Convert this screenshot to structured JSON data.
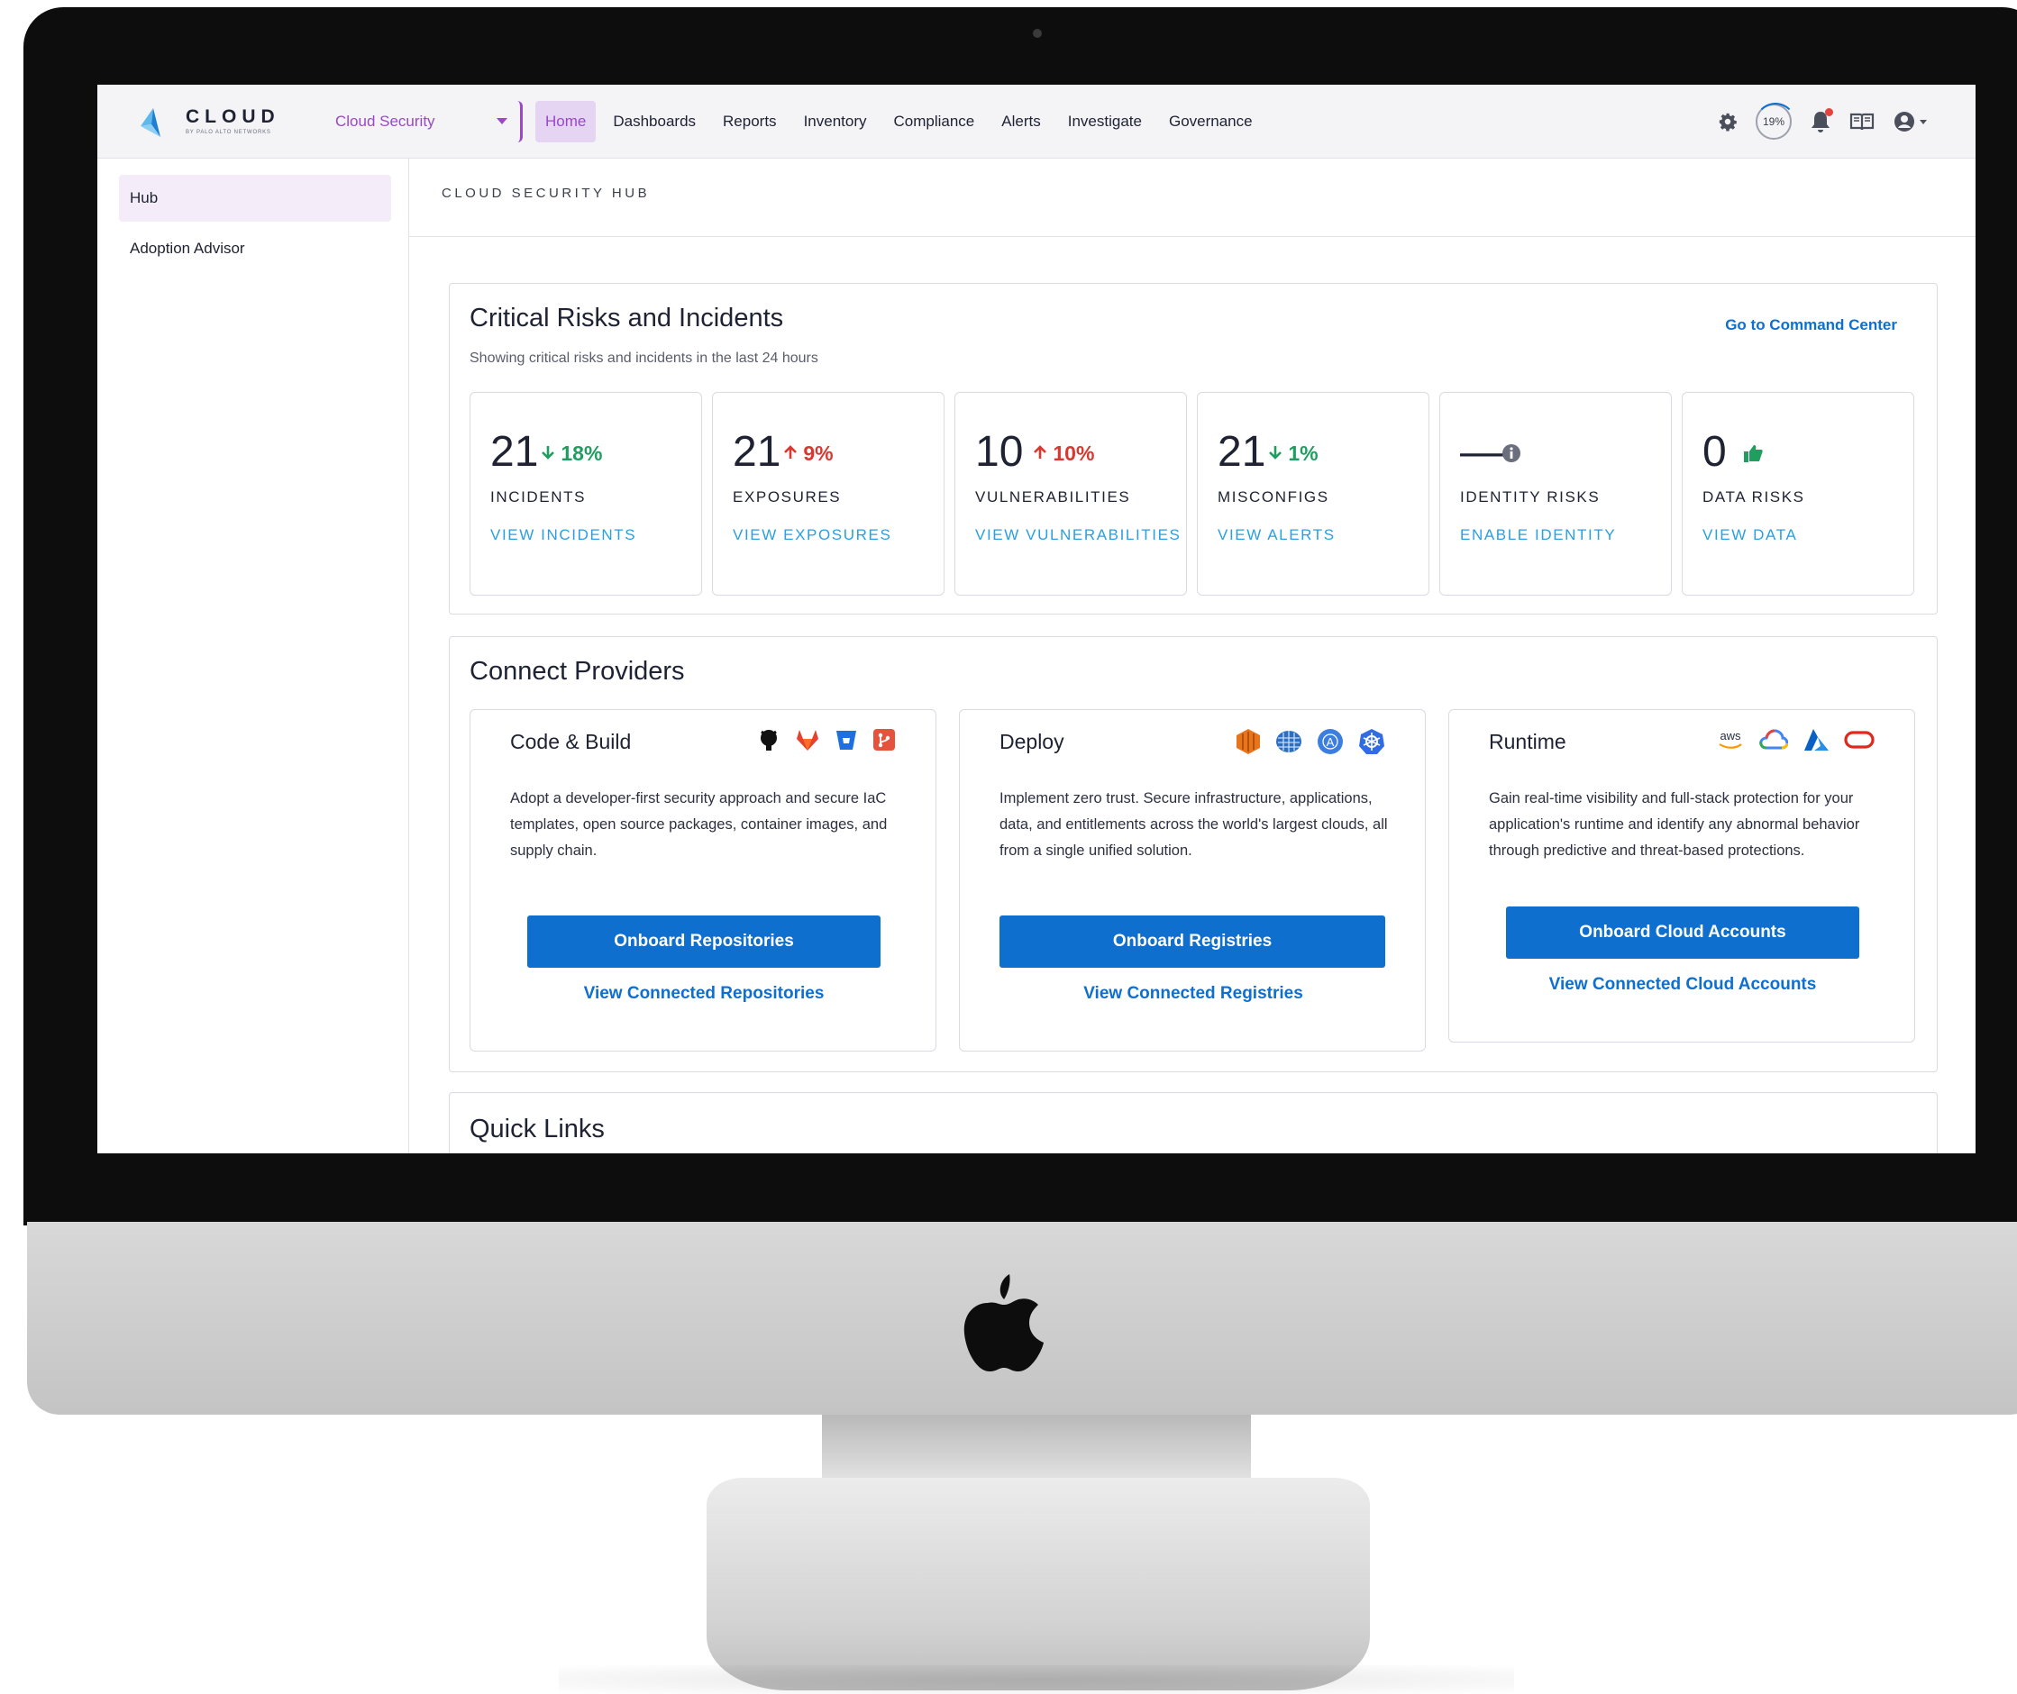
{
  "brand": {
    "name": "CLOUD",
    "subtitle": "BY PALO ALTO NETWORKS"
  },
  "product_select": {
    "value": "Cloud Security"
  },
  "nav": {
    "items": [
      {
        "label": "Home",
        "active": true
      },
      {
        "label": "Dashboards"
      },
      {
        "label": "Reports"
      },
      {
        "label": "Inventory"
      },
      {
        "label": "Compliance"
      },
      {
        "label": "Alerts"
      },
      {
        "label": "Investigate"
      },
      {
        "label": "Governance"
      }
    ]
  },
  "top_icons": {
    "settings": "gear-icon",
    "progress_label": "19%",
    "notifications": "bell-icon",
    "docs": "book-icon",
    "user": "user-icon"
  },
  "sidebar": {
    "items": [
      {
        "label": "Hub",
        "active": true
      },
      {
        "label": "Adoption Advisor"
      }
    ]
  },
  "page": {
    "title": "CLOUD SECURITY HUB"
  },
  "risks": {
    "title": "Critical Risks and Incidents",
    "subtitle": "Showing critical risks and incidents in the last 24 hours",
    "link": "Go to Command Center",
    "metrics": [
      {
        "value": "21",
        "delta": "18%",
        "direction": "down",
        "label": "INCIDENTS",
        "link": "VIEW INCIDENTS"
      },
      {
        "value": "21",
        "delta": "9%",
        "direction": "up",
        "label": "EXPOSURES",
        "link": "VIEW EXPOSURES"
      },
      {
        "value": "10",
        "delta": "10%",
        "direction": "up",
        "label": "VULNERABILITIES",
        "link": "VIEW VULNERABILITIES"
      },
      {
        "value": "21",
        "delta": "1%",
        "direction": "down",
        "label": "MISCONFIGS",
        "link": "VIEW ALERTS"
      },
      {
        "value": "—",
        "delta": "",
        "direction": "info",
        "label": "IDENTITY RISKS",
        "link": "ENABLE IDENTITY"
      },
      {
        "value": "0",
        "delta": "",
        "direction": "thumbs-up",
        "label": "DATA RISKS",
        "link": "VIEW DATA"
      }
    ]
  },
  "providers": {
    "title": "Connect Providers",
    "cards": [
      {
        "title": "Code & Build",
        "icons": [
          "github-icon",
          "gitlab-icon",
          "bitbucket-icon",
          "git-icon"
        ],
        "description": "Adopt a developer-first security approach and secure IaC templates, open source packages, container images, and supply chain.",
        "button": "Onboard Repositories",
        "link": "View Connected Repositories"
      },
      {
        "title": "Deploy",
        "icons": [
          "aws-ecr-icon",
          "registry-icon",
          "azure-registry-icon",
          "kubernetes-icon"
        ],
        "description": "Implement zero trust. Secure infrastructure, applications, data, and entitlements across the world's largest clouds, all from a single unified solution.",
        "button": "Onboard Registries",
        "link": "View Connected Registries"
      },
      {
        "title": "Runtime",
        "icons": [
          "aws-icon",
          "google-cloud-icon",
          "azure-icon",
          "oracle-icon"
        ],
        "description": "Gain real-time visibility and full-stack  protection for your application's runtime and identify any abnormal behavior through predictive and threat-based protections.",
        "button": "Onboard Cloud Accounts",
        "link": "View Connected Cloud Accounts"
      }
    ]
  },
  "quick_links": {
    "title": "Quick Links"
  },
  "aws_text": "aws",
  "colors": {
    "accent_purple": "#9a48c8",
    "primary_blue": "#0e6fcf",
    "link_blue": "#2b9fe0",
    "down_green": "#1f9e5f",
    "up_red": "#d9382f"
  }
}
